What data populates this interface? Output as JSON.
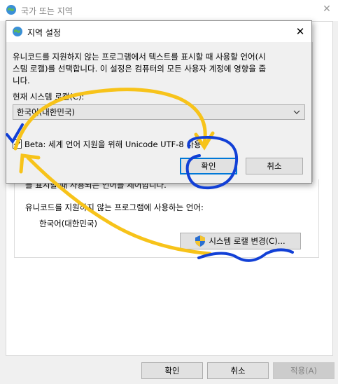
{
  "bg_window": {
    "title": "국가 또는 지역",
    "partial_text": "를 표시할 때 사용되는 언어를 제어합니다.",
    "non_unicode_label": "유니코드를 지원하지 않는 프로그램에 사용하는 언어:",
    "current_language": "한국어(대한민국)",
    "change_locale_button": "시스템 로캘 변경(C)...",
    "footer": {
      "ok": "확인",
      "cancel": "취소",
      "apply": "적용(A)"
    }
  },
  "dialog": {
    "title": "지역 설정",
    "close_glyph": "✕",
    "description_line1": "유니코드를 지원하지 않는 프로그램에서 텍스트를 표시할 때 사용할 언어(시",
    "description_line2": "스템 로캘)를 선택합니다. 이 설정은 컴퓨터의 모든 사용자 계정에 영향을 줍",
    "description_line3": "니다.",
    "locale_label": "현재 시스템 로캘(C):",
    "locale_value": "한국어(대한민국)",
    "utf8_checkbox_label": "Beta: 세계 언어 지원을 위해 Unicode UTF-8 사용",
    "utf8_checked": true,
    "ok_button": "확인",
    "cancel_button": "취소"
  },
  "icons": {
    "window_icon": "globe-icon",
    "dialog_icon": "globe-icon",
    "shield": "uac-shield-icon",
    "dropdown": "chevron-down-icon"
  },
  "colors": {
    "annotation_yellow": "#f7c31a",
    "annotation_blue": "#1240d6",
    "focus_blue": "#0078d7"
  }
}
